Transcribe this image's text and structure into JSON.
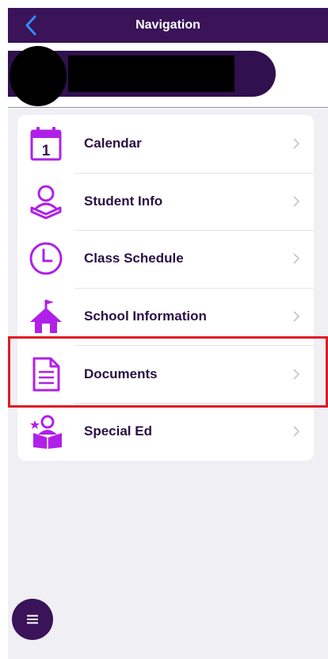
{
  "nav": {
    "title": "Navigation",
    "back_icon": "chevron-left-icon"
  },
  "menu": {
    "items": [
      {
        "label": "Calendar",
        "icon": "calendar-icon"
      },
      {
        "label": "Student Info",
        "icon": "student-icon"
      },
      {
        "label": "Class Schedule",
        "icon": "clock-icon"
      },
      {
        "label": "School Information",
        "icon": "school-icon"
      },
      {
        "label": "Documents",
        "icon": "document-icon"
      },
      {
        "label": "Special Ed",
        "icon": "special-ed-icon"
      }
    ],
    "calendar_day": "1"
  },
  "colors": {
    "nav_bar": "#3a1358",
    "accent_purple": "#b020e8",
    "back_arrow": "#2f8cff",
    "label_text": "#2a1144",
    "background": "#efeff4",
    "highlight": "#e01b24"
  },
  "fab": {
    "icon": "hamburger-menu-icon"
  }
}
